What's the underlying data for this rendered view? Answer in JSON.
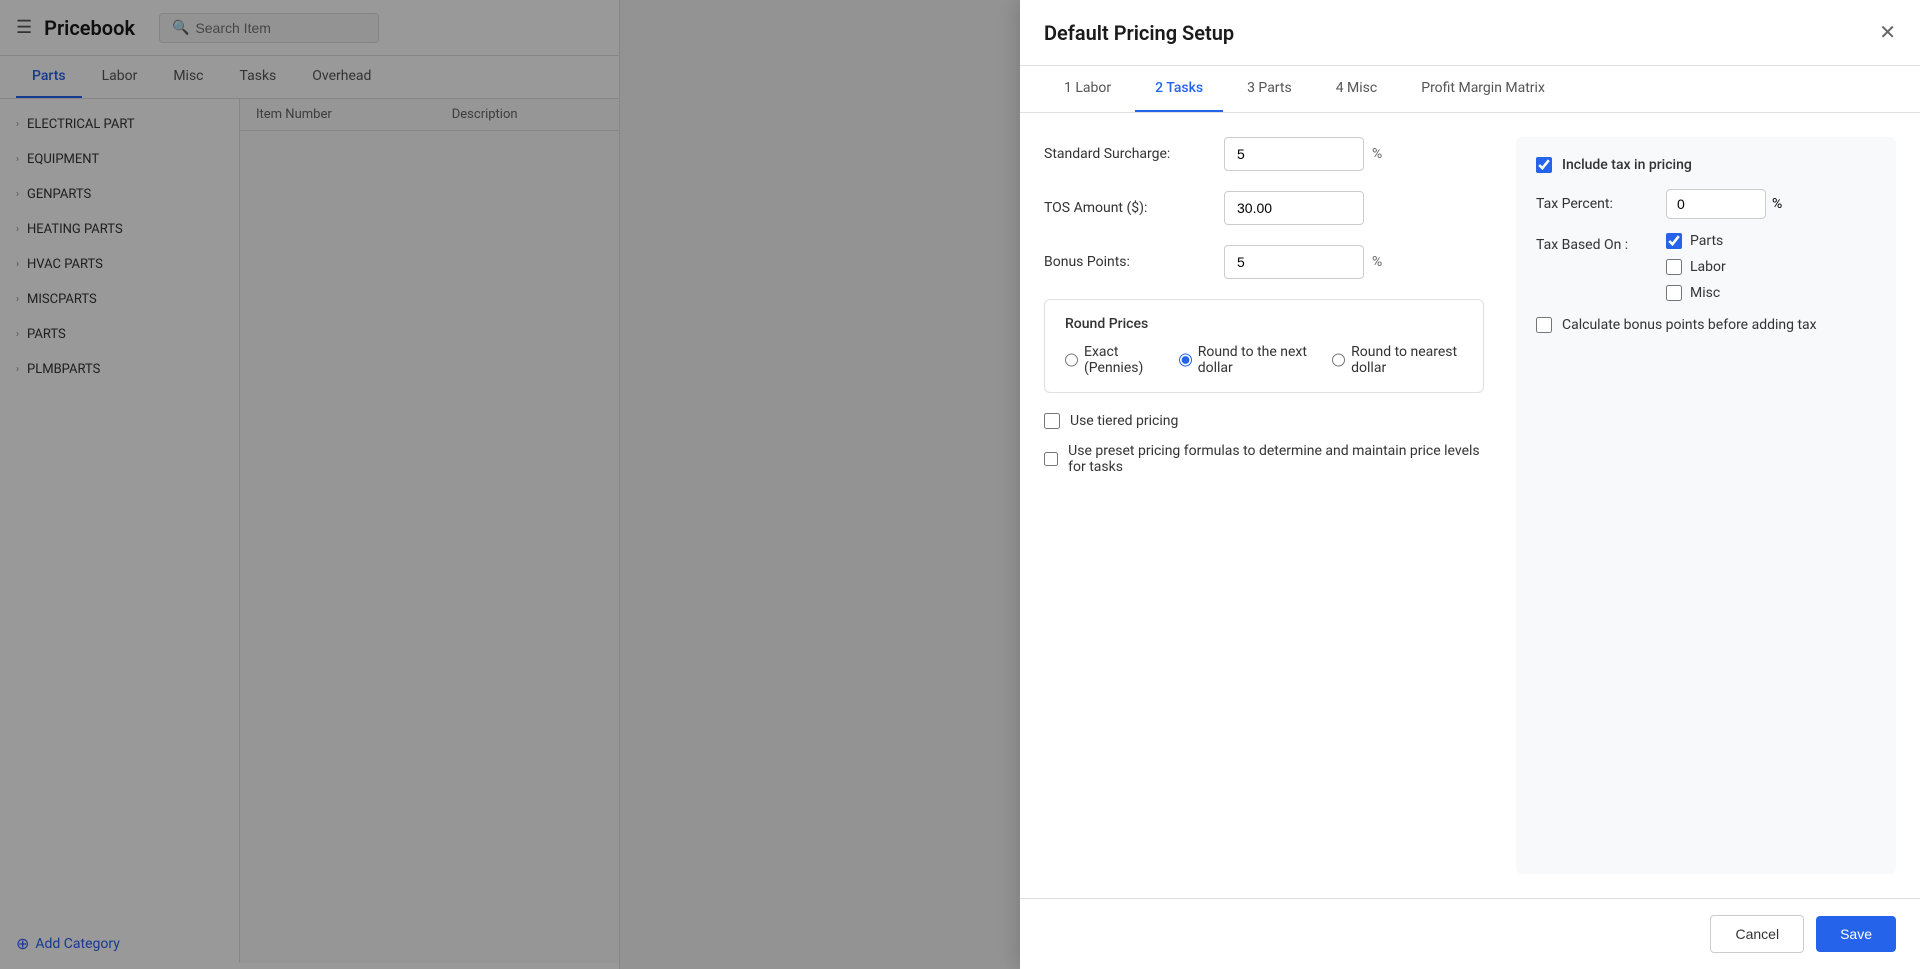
{
  "app": {
    "title": "Pricebook",
    "search_placeholder": "Search Item"
  },
  "nav_tabs": [
    {
      "id": "parts",
      "label": "Parts",
      "active": true
    },
    {
      "id": "labor",
      "label": "Labor",
      "active": false
    },
    {
      "id": "misc",
      "label": "Misc",
      "active": false
    },
    {
      "id": "tasks",
      "label": "Tasks",
      "active": false
    },
    {
      "id": "overhead",
      "label": "Overhead",
      "active": false
    }
  ],
  "categories": [
    {
      "label": "ELECTRICAL PART"
    },
    {
      "label": "EQUIPMENT"
    },
    {
      "label": "GENPARTS"
    },
    {
      "label": "HEATING PARTS"
    },
    {
      "label": "HVAC PARTS"
    },
    {
      "label": "MISCPARTS"
    },
    {
      "label": "PARTS"
    },
    {
      "label": "PLMBPARTS"
    }
  ],
  "add_category_label": "Add Category",
  "table_columns": {
    "item_number": "Item Number",
    "description": "Description"
  },
  "modal": {
    "title": "Default Pricing Setup",
    "tabs": [
      {
        "id": "labor",
        "label": "1 Labor",
        "active": false
      },
      {
        "id": "tasks",
        "label": "2 Tasks",
        "active": true
      },
      {
        "id": "parts",
        "label": "3 Parts",
        "active": false
      },
      {
        "id": "misc",
        "label": "4 Misc",
        "active": false
      },
      {
        "id": "profit_margin",
        "label": "Profit Margin Matrix",
        "active": false
      }
    ],
    "form": {
      "standard_surcharge_label": "Standard Surcharge:",
      "standard_surcharge_value": "5",
      "standard_surcharge_unit": "%",
      "tos_amount_label": "TOS Amount ($):",
      "tos_amount_value": "30.00",
      "bonus_points_label": "Bonus Points:",
      "bonus_points_value": "5",
      "bonus_points_unit": "%",
      "round_prices_title": "Round Prices",
      "round_options": [
        {
          "id": "exact",
          "label": "Exact (Pennies)",
          "checked": false
        },
        {
          "id": "round_next",
          "label": "Round to the next dollar",
          "checked": true
        },
        {
          "id": "round_nearest",
          "label": "Round to nearest dollar",
          "checked": false
        }
      ],
      "use_tiered_pricing_label": "Use tiered pricing",
      "use_tiered_pricing_checked": false,
      "use_preset_pricing_label": "Use preset pricing formulas to determine and maintain price levels for tasks",
      "use_preset_pricing_checked": false
    },
    "right_panel": {
      "include_tax_label": "Include tax in pricing",
      "include_tax_checked": true,
      "tax_percent_label": "Tax Percent:",
      "tax_percent_value": "0",
      "tax_percent_unit": "%",
      "tax_based_on_label": "Tax Based On :",
      "tax_based_options": [
        {
          "id": "parts",
          "label": "Parts",
          "checked": true
        },
        {
          "id": "labor",
          "label": "Labor",
          "checked": false
        },
        {
          "id": "misc",
          "label": "Misc",
          "checked": false
        }
      ],
      "calc_bonus_label": "Calculate bonus points before adding tax",
      "calc_bonus_checked": false
    },
    "footer": {
      "cancel_label": "Cancel",
      "save_label": "Save"
    }
  }
}
